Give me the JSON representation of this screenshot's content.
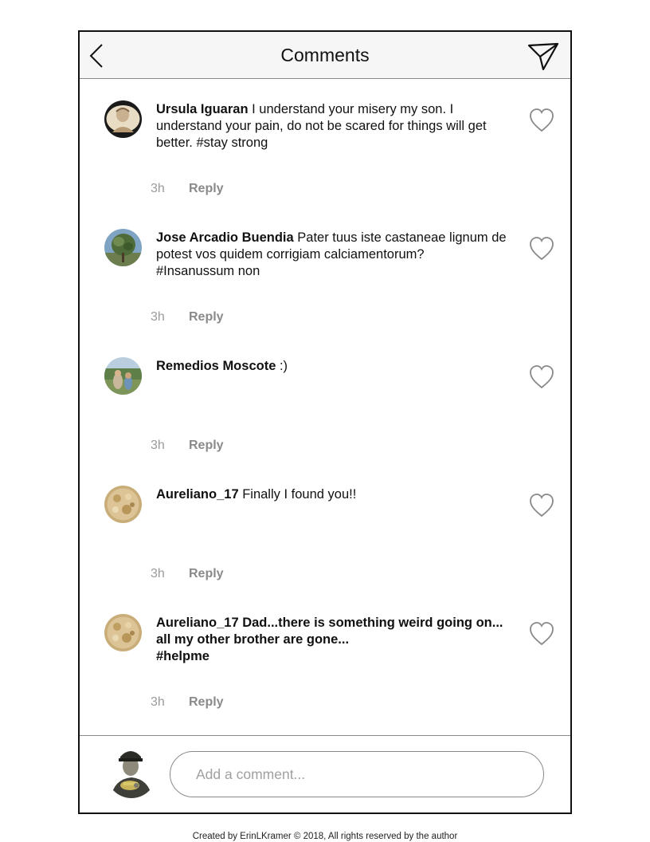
{
  "header": {
    "title": "Comments"
  },
  "icons": {
    "back": "chevron-left-icon",
    "send": "paper-plane-icon",
    "like": "heart-icon"
  },
  "comments": [
    {
      "username": "Ursula Iguaran",
      "text": " I understand your misery my son. I understand your pain, do not be scared for things will get better. #stay strong",
      "hashtag": "",
      "username_bold": true,
      "time": "3h",
      "reply_label": "Reply"
    },
    {
      "username": "Jose Arcadio Buendia",
      "text": " Pater tuus iste castaneae lignum de potest vos quidem corrigiam calciamentorum?",
      "hashtag": "#Insanussum non",
      "username_bold": true,
      "time": "3h",
      "reply_label": "Reply"
    },
    {
      "username": "Remedios Moscote",
      "text": "  :)",
      "hashtag": "",
      "username_bold": true,
      "time": "3h",
      "reply_label": "Reply"
    },
    {
      "username": "Aureliano_17",
      "text": " Finally I found you!!",
      "hashtag": "",
      "username_bold": true,
      "time": "3h",
      "reply_label": "Reply"
    },
    {
      "username": "Aureliano_17",
      "text": "  Dad...there is something weird going on... all my other brother are gone...",
      "hashtag": "#helpme",
      "username_bold": false,
      "time": "3h",
      "reply_label": "Reply"
    }
  ],
  "composer": {
    "placeholder": "Add a comment..."
  },
  "footer": {
    "credit": "Created by ErinLKramer © 2018, All rights reserved by the author"
  }
}
